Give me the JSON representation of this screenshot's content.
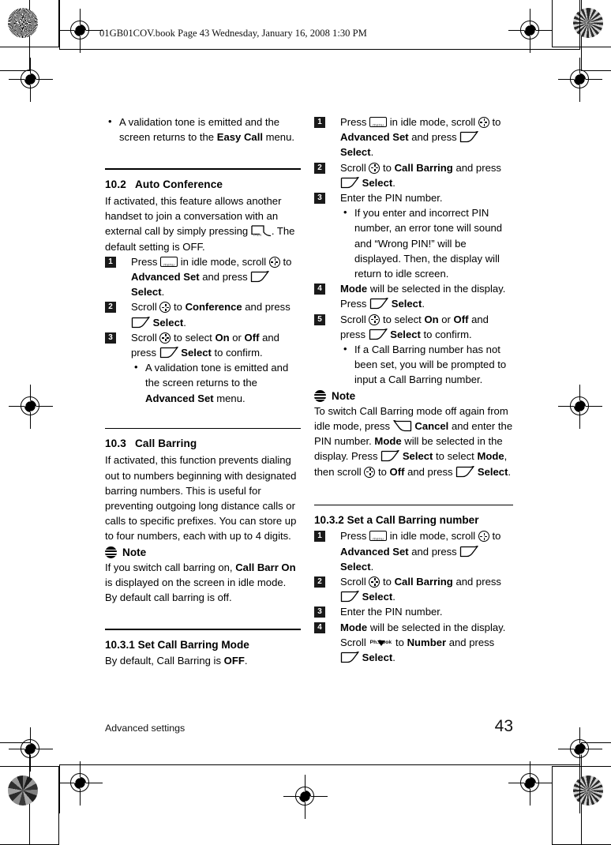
{
  "page": {
    "book_line": "01GB01COV.book  Page 43  Wednesday, January 16, 2008  1:30 PM",
    "footer_title": "Advanced settings",
    "page_number": "43"
  },
  "icons": {
    "menu_key": "menu-key-icon",
    "menu_key_label": "menu",
    "nav_key": "navigation-scroll-icon",
    "soft_key": "softkey-left-icon",
    "soft_key_cancel": "softkey-right-cancel-icon",
    "talk_key": "talk-key-icon",
    "talk_key_label": "TALK",
    "phonebook_key": "phonebook-key-icon",
    "phonebook_key_label": "Ph.Book",
    "note_icon": "note-icon"
  },
  "left_column": {
    "carryover_bullets": [
      {
        "pre": "A validation tone is emitted and the screen returns to the ",
        "bold": "Easy Call",
        "post": " menu."
      }
    ],
    "section_10_2": {
      "number": "10.2",
      "title": "Auto Conference",
      "intro_a": "If activated, this feature allows another handset to join a conversation with an external call by simply pressing ",
      "intro_b": ". The default setting is OFF.",
      "steps": [
        {
          "n": "1",
          "a": "Press ",
          "b": " in idle mode, scroll ",
          "c": " to ",
          "bold1": "Advanced Set",
          "d": " and press ",
          "bold2": "Select",
          "e": "."
        },
        {
          "n": "2",
          "a": "Scroll ",
          "b": " to ",
          "bold1": "Conference",
          "c": " and press ",
          "bold2": "Select",
          "d": "."
        },
        {
          "n": "3",
          "a": "Scroll ",
          "b": " to select ",
          "bold1": "On",
          "c": " or ",
          "bold2": "Off",
          "d": " and press ",
          "bold3": "Select",
          "e": " to confirm."
        }
      ],
      "sub_bullet": {
        "pre": "A validation tone is emitted and the screen returns to the ",
        "bold": "Advanced Set",
        "post": " menu."
      }
    },
    "section_10_3": {
      "number": "10.3",
      "title": "Call Barring",
      "body": "If activated, this function prevents dialing out to numbers beginning with designated barring numbers. This is useful for preventing outgoing long distance calls or calls to specific prefixes. You can store up to four numbers, each with up to 4 digits.",
      "note_label": "Note",
      "note_a": "If you switch call barring on, ",
      "note_bold1": "Call Barr On",
      "note_b": " is displayed on the screen in idle mode. By default call barring is off."
    },
    "section_10_3_1": {
      "title": "10.3.1 Set Call Barring Mode",
      "body_a": "By default, Call Barring is ",
      "body_bold": "OFF",
      "body_b": "."
    }
  },
  "right_column": {
    "steps_mode": [
      {
        "n": "1",
        "a": "Press ",
        "b": " in idle mode, scroll ",
        "c": " to ",
        "bold1": "Advanced Set",
        "d": " and press ",
        "bold2": "Select",
        "e": "."
      },
      {
        "n": "2",
        "a": "Scroll ",
        "b": " to ",
        "bold1": "Call Barring",
        "c": " and press ",
        "bold2": "Select",
        "d": "."
      },
      {
        "n": "3",
        "a": "Enter the PIN number."
      }
    ],
    "pin_bullet": "If you enter and incorrect PIN number, an error tone will sound and “Wrong PIN!” will be displayed. Then, the display will return to idle screen.",
    "step_4": {
      "n": "4",
      "bold1": "Mode",
      "a": " will be selected in the display. Press ",
      "bold2": "Select",
      "b": "."
    },
    "step_5": {
      "n": "5",
      "a": "Scroll ",
      "b": " to select ",
      "bold1": "On",
      "c": " or ",
      "bold2": "Off",
      "d": " and press ",
      "bold3": "Select",
      "e": " to confirm."
    },
    "step_5_bullet": "If a Call Barring number has not been set, you will be prompted to input a Call Barring number.",
    "note_label": "Note",
    "note_a": "To switch Call Barring mode off again from idle mode, press ",
    "note_bold1": "Cancel",
    "note_b": " and enter the PIN number. ",
    "note_bold2": "Mode",
    "note_c": " will be selected in the display. Press ",
    "note_bold3": "Select",
    "note_d": " to select ",
    "note_bold4": "Mode",
    "note_e": ", then scroll ",
    "note_f": " to ",
    "note_bold5": "Off",
    "note_g": " and press ",
    "note_bold6": "Select",
    "note_h": ".",
    "section_10_3_2": {
      "title": "10.3.2 Set a Call Barring number",
      "steps": [
        {
          "n": "1",
          "a": "Press ",
          "b": " in idle mode, scroll ",
          "c": " to ",
          "bold1": "Advanced Set",
          "d": " and press ",
          "bold2": "Select",
          "e": "."
        },
        {
          "n": "2",
          "a": "Scroll ",
          "b": " to ",
          "bold1": "Call Barring",
          "c": " and press ",
          "bold2": "Select",
          "d": "."
        },
        {
          "n": "3",
          "a": "Enter the PIN number."
        }
      ],
      "step_4": {
        "n": "4",
        "bold1": "Mode",
        "a": " will be selected in the display. Scroll ",
        "b": " to ",
        "bold2": "Number",
        "c": " and press ",
        "bold3": "Select",
        "d": "."
      }
    }
  }
}
